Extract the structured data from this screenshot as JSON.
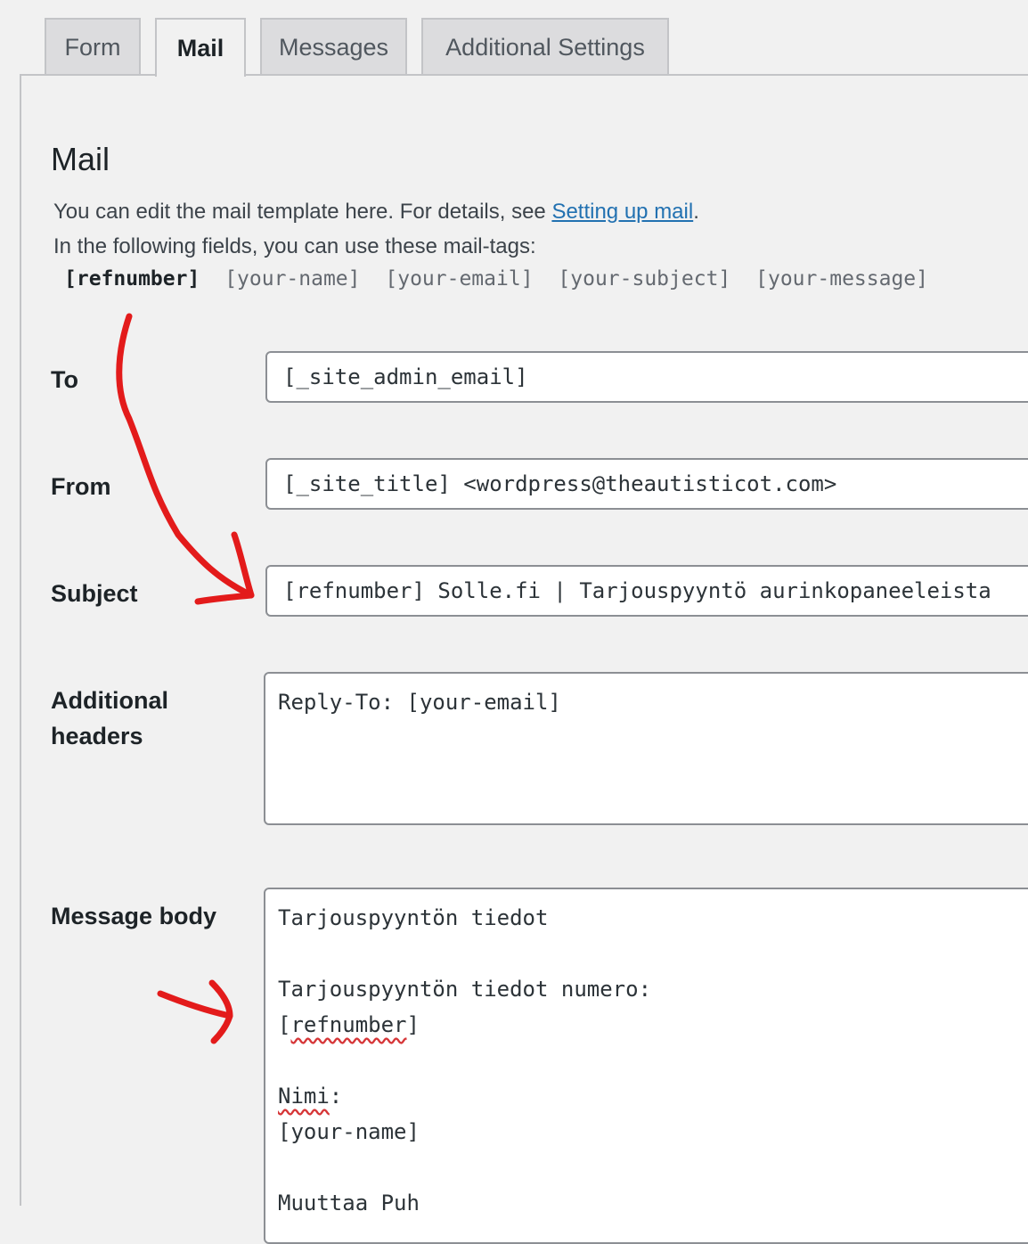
{
  "tabs": [
    {
      "label": "Form"
    },
    {
      "label": "Mail"
    },
    {
      "label": "Messages"
    },
    {
      "label": "Additional Settings"
    }
  ],
  "mail": {
    "heading": "Mail",
    "intro_prefix": "You can edit the mail template here. For details, see ",
    "intro_link": "Setting up mail",
    "intro_suffix": ".",
    "tags_intro": "In the following fields, you can use these mail-tags:",
    "mail_tags": [
      "[refnumber]",
      "[your-name]",
      "[your-email]",
      "[your-subject]",
      "[your-message]"
    ]
  },
  "fields": {
    "to": {
      "label": "To",
      "value": "[_site_admin_email]"
    },
    "from": {
      "label": "From",
      "value": "[_site_title] <wordpress@theautisticot.com>"
    },
    "subject": {
      "label": "Subject",
      "value": "[refnumber] Solle.fi | Tarjouspyyntö aurinkopaneeleista"
    },
    "headers": {
      "label_line1": "Additional",
      "label_line2": "headers",
      "value": "Reply-To: [your-email]"
    },
    "body": {
      "label": "Message body",
      "lines": [
        "Tarjouspyyntön tiedot",
        "",
        "Tarjouspyyntön tiedot numero:",
        "[refnumber]",
        "",
        "Nimi:",
        "[your-name]",
        "",
        "Muuttaa Puh"
      ]
    }
  },
  "colors": {
    "annotation": "#e31b1b",
    "link": "#2271b1"
  }
}
